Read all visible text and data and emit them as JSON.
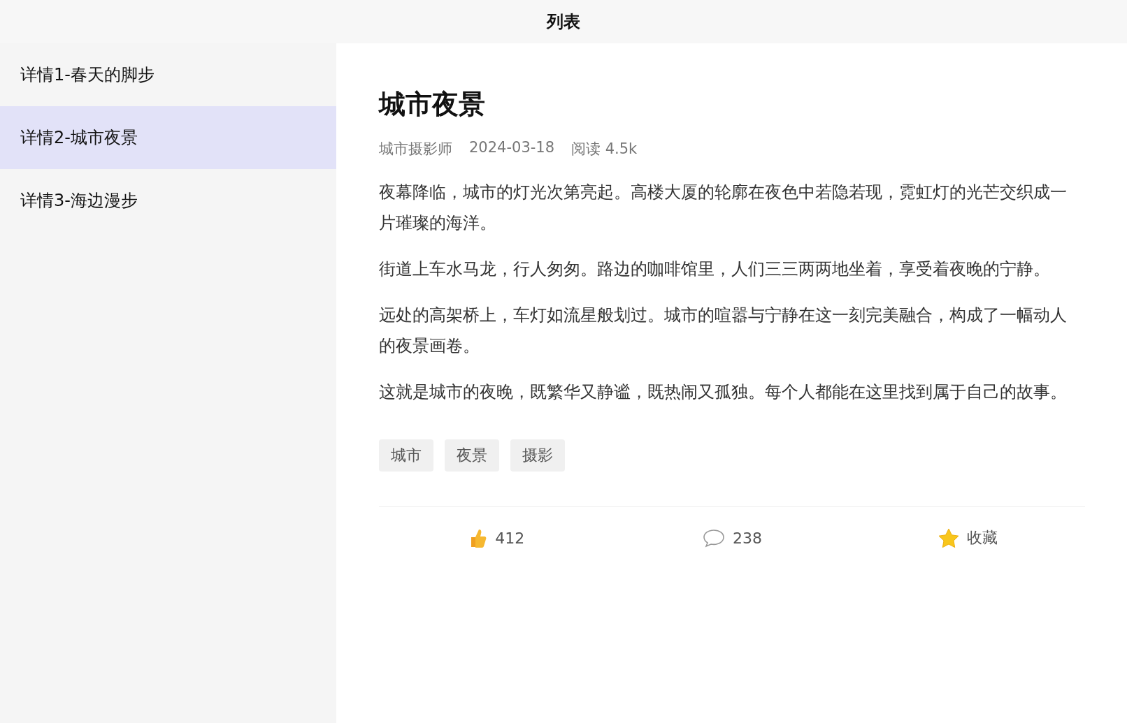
{
  "header": {
    "title": "列表"
  },
  "sidebar": {
    "items": [
      {
        "label": "详情1-春天的脚步",
        "selected": false
      },
      {
        "label": "详情2-城市夜景",
        "selected": true
      },
      {
        "label": "详情3-海边漫步",
        "selected": false
      }
    ]
  },
  "article": {
    "title": "城市夜景",
    "meta": [
      "城市摄影师",
      "2024-03-18",
      "阅读 4.5k"
    ],
    "paragraphs": [
      "夜幕降临，城市的灯光次第亮起。高楼大厦的轮廓在夜色中若隐若现，霓虹灯的光芒交织成一片璀璨的海洋。",
      "街道上车水马龙，行人匆匆。路边的咖啡馆里，人们三三两两地坐着，享受着夜晚的宁静。",
      "远处的高架桥上，车灯如流星般划过。城市的喧嚣与宁静在这一刻完美融合，构成了一幅动人的夜景画卷。",
      "这就是城市的夜晚，既繁华又静谧，既热闹又孤独。每个人都能在这里找到属于自己的故事。"
    ],
    "tags": [
      "城市",
      "夜景",
      "摄影"
    ],
    "actions": [
      {
        "kind": "like",
        "label": "412"
      },
      {
        "kind": "comment",
        "label": "238"
      },
      {
        "kind": "favorite",
        "label": "收藏"
      }
    ]
  }
}
